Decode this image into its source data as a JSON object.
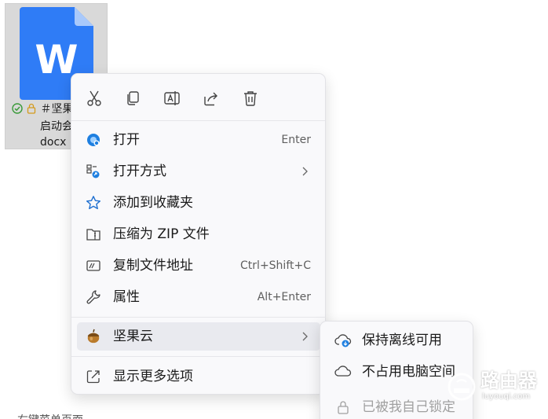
{
  "file": {
    "name_line1": "＃坚果",
    "name_line2": "启动会",
    "name_line3": "docx",
    "icon_letter": "W",
    "status_icons": [
      "synced-check-icon",
      "lock-icon"
    ]
  },
  "toolbar": {
    "buttons": [
      "cut-icon",
      "copy-icon",
      "rename-icon",
      "share-icon",
      "delete-icon"
    ]
  },
  "menu": {
    "items": [
      {
        "label": "打开",
        "shortcut": "Enter",
        "icon": "open-app-icon"
      },
      {
        "label": "打开方式",
        "icon": "open-with-icon",
        "submenu": true
      },
      {
        "label": "添加到收藏夹",
        "icon": "star-icon"
      },
      {
        "label": "压缩为 ZIP 文件",
        "icon": "zip-folder-icon"
      },
      {
        "label": "复制文件地址",
        "shortcut": "Ctrl+Shift+C",
        "icon": "copy-path-icon"
      },
      {
        "label": "属性",
        "shortcut": "Alt+Enter",
        "icon": "wrench-icon"
      },
      {
        "label": "坚果云",
        "icon": "nut-cloud-icon",
        "submenu": true
      },
      {
        "label": "显示更多选项",
        "icon": "show-more-icon"
      }
    ]
  },
  "submenu": {
    "items": [
      {
        "label": "保持离线可用",
        "icon": "cloud-download-icon"
      },
      {
        "label": "不占用电脑空间",
        "icon": "cloud-icon"
      },
      {
        "label": "已被我自己锁定",
        "icon": "lock-icon",
        "disabled": true
      }
    ]
  },
  "background": {
    "partial_text": "右键菜单页面"
  },
  "watermark": {
    "title": "路由器",
    "subtitle": "luyouqi.com"
  },
  "colors": {
    "word_blue": "#2f7cf6",
    "accent": "#0067c0",
    "menu_bg": "#f9f9fb",
    "hover": "#e9eaef"
  }
}
